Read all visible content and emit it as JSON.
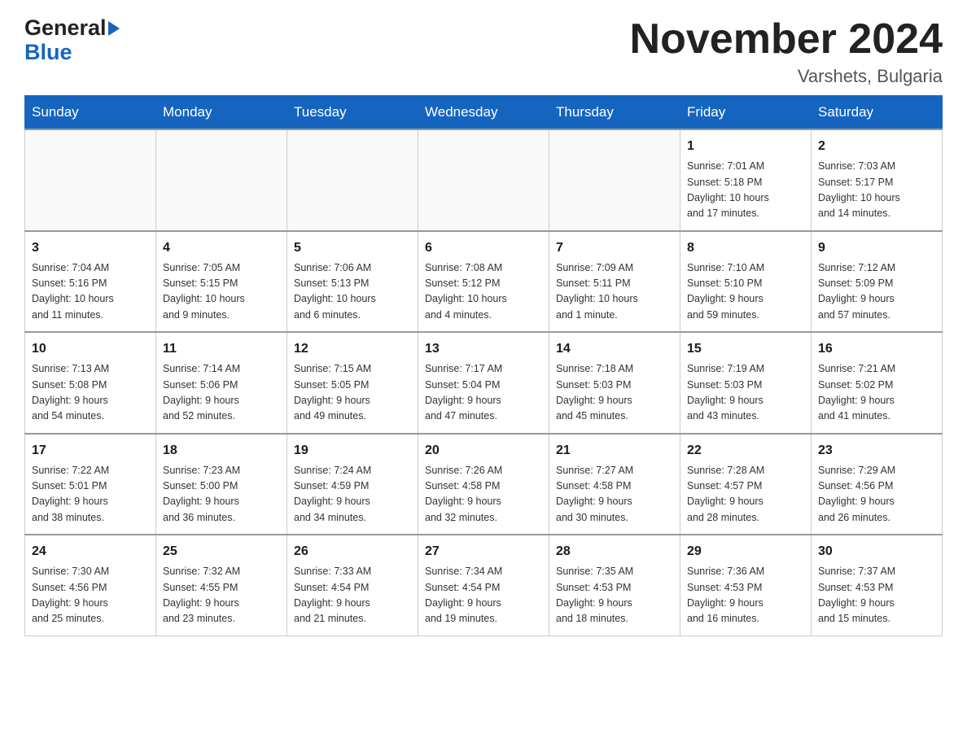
{
  "header": {
    "logo_general": "General",
    "logo_blue": "Blue",
    "title": "November 2024",
    "subtitle": "Varshets, Bulgaria"
  },
  "days_of_week": [
    "Sunday",
    "Monday",
    "Tuesday",
    "Wednesday",
    "Thursday",
    "Friday",
    "Saturday"
  ],
  "weeks": [
    [
      {
        "day": "",
        "info": ""
      },
      {
        "day": "",
        "info": ""
      },
      {
        "day": "",
        "info": ""
      },
      {
        "day": "",
        "info": ""
      },
      {
        "day": "",
        "info": ""
      },
      {
        "day": "1",
        "info": "Sunrise: 7:01 AM\nSunset: 5:18 PM\nDaylight: 10 hours\nand 17 minutes."
      },
      {
        "day": "2",
        "info": "Sunrise: 7:03 AM\nSunset: 5:17 PM\nDaylight: 10 hours\nand 14 minutes."
      }
    ],
    [
      {
        "day": "3",
        "info": "Sunrise: 7:04 AM\nSunset: 5:16 PM\nDaylight: 10 hours\nand 11 minutes."
      },
      {
        "day": "4",
        "info": "Sunrise: 7:05 AM\nSunset: 5:15 PM\nDaylight: 10 hours\nand 9 minutes."
      },
      {
        "day": "5",
        "info": "Sunrise: 7:06 AM\nSunset: 5:13 PM\nDaylight: 10 hours\nand 6 minutes."
      },
      {
        "day": "6",
        "info": "Sunrise: 7:08 AM\nSunset: 5:12 PM\nDaylight: 10 hours\nand 4 minutes."
      },
      {
        "day": "7",
        "info": "Sunrise: 7:09 AM\nSunset: 5:11 PM\nDaylight: 10 hours\nand 1 minute."
      },
      {
        "day": "8",
        "info": "Sunrise: 7:10 AM\nSunset: 5:10 PM\nDaylight: 9 hours\nand 59 minutes."
      },
      {
        "day": "9",
        "info": "Sunrise: 7:12 AM\nSunset: 5:09 PM\nDaylight: 9 hours\nand 57 minutes."
      }
    ],
    [
      {
        "day": "10",
        "info": "Sunrise: 7:13 AM\nSunset: 5:08 PM\nDaylight: 9 hours\nand 54 minutes."
      },
      {
        "day": "11",
        "info": "Sunrise: 7:14 AM\nSunset: 5:06 PM\nDaylight: 9 hours\nand 52 minutes."
      },
      {
        "day": "12",
        "info": "Sunrise: 7:15 AM\nSunset: 5:05 PM\nDaylight: 9 hours\nand 49 minutes."
      },
      {
        "day": "13",
        "info": "Sunrise: 7:17 AM\nSunset: 5:04 PM\nDaylight: 9 hours\nand 47 minutes."
      },
      {
        "day": "14",
        "info": "Sunrise: 7:18 AM\nSunset: 5:03 PM\nDaylight: 9 hours\nand 45 minutes."
      },
      {
        "day": "15",
        "info": "Sunrise: 7:19 AM\nSunset: 5:03 PM\nDaylight: 9 hours\nand 43 minutes."
      },
      {
        "day": "16",
        "info": "Sunrise: 7:21 AM\nSunset: 5:02 PM\nDaylight: 9 hours\nand 41 minutes."
      }
    ],
    [
      {
        "day": "17",
        "info": "Sunrise: 7:22 AM\nSunset: 5:01 PM\nDaylight: 9 hours\nand 38 minutes."
      },
      {
        "day": "18",
        "info": "Sunrise: 7:23 AM\nSunset: 5:00 PM\nDaylight: 9 hours\nand 36 minutes."
      },
      {
        "day": "19",
        "info": "Sunrise: 7:24 AM\nSunset: 4:59 PM\nDaylight: 9 hours\nand 34 minutes."
      },
      {
        "day": "20",
        "info": "Sunrise: 7:26 AM\nSunset: 4:58 PM\nDaylight: 9 hours\nand 32 minutes."
      },
      {
        "day": "21",
        "info": "Sunrise: 7:27 AM\nSunset: 4:58 PM\nDaylight: 9 hours\nand 30 minutes."
      },
      {
        "day": "22",
        "info": "Sunrise: 7:28 AM\nSunset: 4:57 PM\nDaylight: 9 hours\nand 28 minutes."
      },
      {
        "day": "23",
        "info": "Sunrise: 7:29 AM\nSunset: 4:56 PM\nDaylight: 9 hours\nand 26 minutes."
      }
    ],
    [
      {
        "day": "24",
        "info": "Sunrise: 7:30 AM\nSunset: 4:56 PM\nDaylight: 9 hours\nand 25 minutes."
      },
      {
        "day": "25",
        "info": "Sunrise: 7:32 AM\nSunset: 4:55 PM\nDaylight: 9 hours\nand 23 minutes."
      },
      {
        "day": "26",
        "info": "Sunrise: 7:33 AM\nSunset: 4:54 PM\nDaylight: 9 hours\nand 21 minutes."
      },
      {
        "day": "27",
        "info": "Sunrise: 7:34 AM\nSunset: 4:54 PM\nDaylight: 9 hours\nand 19 minutes."
      },
      {
        "day": "28",
        "info": "Sunrise: 7:35 AM\nSunset: 4:53 PM\nDaylight: 9 hours\nand 18 minutes."
      },
      {
        "day": "29",
        "info": "Sunrise: 7:36 AM\nSunset: 4:53 PM\nDaylight: 9 hours\nand 16 minutes."
      },
      {
        "day": "30",
        "info": "Sunrise: 7:37 AM\nSunset: 4:53 PM\nDaylight: 9 hours\nand 15 minutes."
      }
    ]
  ]
}
